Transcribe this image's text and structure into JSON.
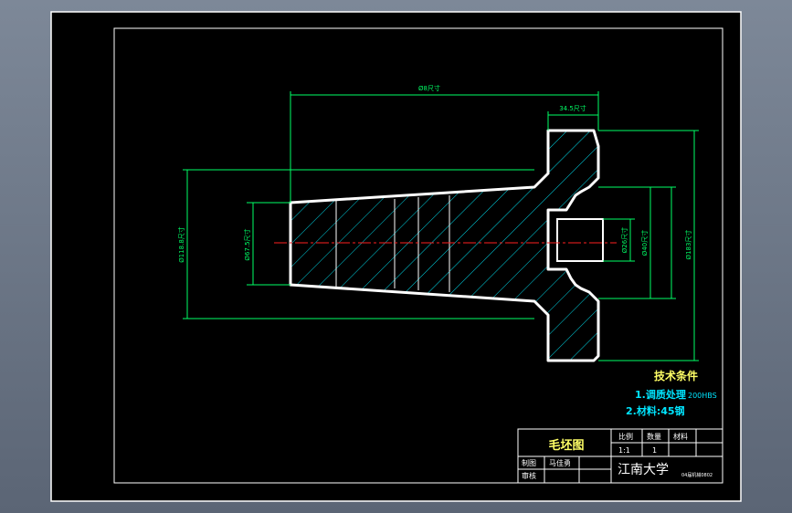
{
  "drawing": {
    "dimensions": {
      "overall_length": "Ø8尺寸",
      "flange_length": "34.5尺寸",
      "left_outer_diameter": "Ø118.8尺寸",
      "left_small_diameter": "Ø67.5尺寸",
      "bore_diameter": "Ø26尺寸",
      "hub_diameter": "Ø40尺寸",
      "flange_diameter": "Ø183尺寸"
    },
    "technical_requirements": {
      "heading": "技术条件",
      "item1": "1.调质处理",
      "item1_value": "200HBS",
      "item2": "2.材料:45钢"
    },
    "title_block": {
      "drawing_name": "毛坯图",
      "scale_label": "比例",
      "scale_value": "1:1",
      "quantity_label": "数量",
      "quantity_value": "1",
      "material_label": "材料",
      "drawn_label": "制图",
      "drawn_name": "马佳勇",
      "checked_label": "审核",
      "school": "江南大学",
      "drawing_number": "04届机械0802"
    }
  }
}
